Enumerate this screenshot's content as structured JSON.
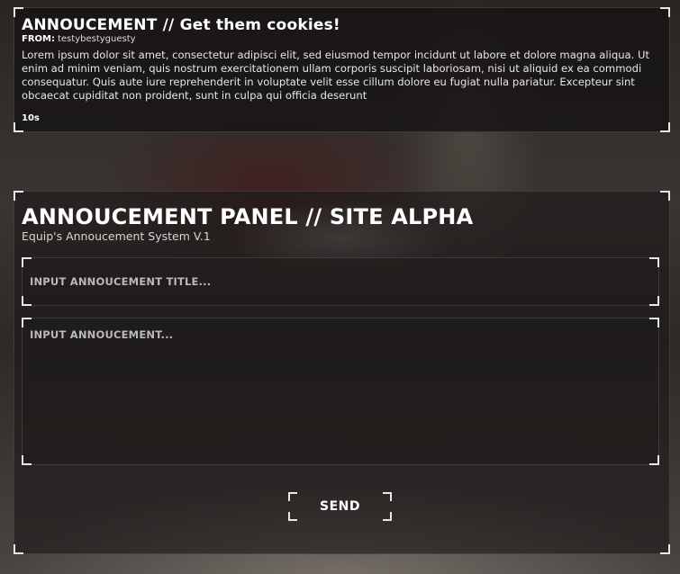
{
  "notification": {
    "title": "ANNOUCEMENT // Get them cookies!",
    "from_label": "FROM:",
    "from_value": "testybestyguesty",
    "body": "Lorem ipsum dolor sit amet, consectetur adipisci elit, sed eiusmod tempor incidunt ut labore et dolore magna aliqua. Ut enim ad minim veniam, quis nostrum exercitationem ullam corporis suscipit laboriosam, nisi ut aliquid ex ea commodi consequatur. Quis aute iure reprehenderit in voluptate velit esse cillum dolore eu fugiat nulla pariatur. Excepteur sint obcaecat cupiditat non proident, sunt in culpa qui officia deserunt",
    "timer": "10s"
  },
  "panel": {
    "title": "ANNOUCEMENT PANEL // SITE ALPHA",
    "subtitle": "Equip's Annoucement System V.1",
    "title_input": {
      "value": "",
      "placeholder": "INPUT ANNOUCEMENT TITLE..."
    },
    "body_input": {
      "value": "",
      "placeholder": "INPUT ANNOUCEMENT..."
    },
    "send_label": "SEND"
  }
}
